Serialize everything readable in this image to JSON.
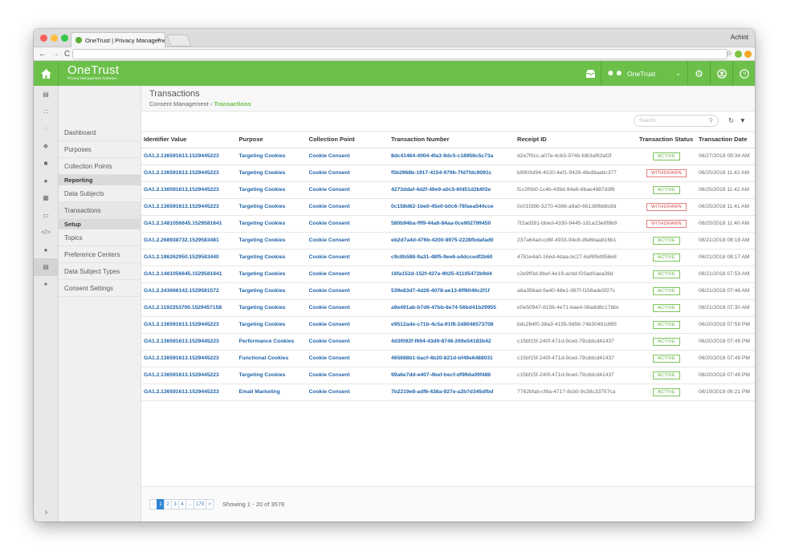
{
  "browser": {
    "tab_title": "OneTrust | Privacy Manageme",
    "tab_close": "×",
    "user": "Achint",
    "back": "←",
    "forward": "→",
    "reload": "C",
    "star": "☆"
  },
  "topbar": {
    "logo": "OneTrust",
    "logo_tagline": "Privacy Management Software",
    "org_name": "OneTrust",
    "accent_color": "#6cc04a"
  },
  "subnav": {
    "items_top": [
      "Dashboard",
      "Purposes",
      "Collection Points"
    ],
    "section_reporting": "Reporting",
    "items_reporting": [
      "Data Subjects",
      "Transactions"
    ],
    "section_setup": "Setup",
    "items_setup": [
      "Topics",
      "Preference Centers",
      "Data Subject Types",
      "Consent Settings"
    ]
  },
  "page": {
    "title": "Transactions",
    "crumb_parent": "Consent Management",
    "crumb_sep": " › ",
    "crumb_current": "Transactions"
  },
  "search": {
    "placeholder": "Search"
  },
  "table": {
    "headers": [
      "Identifier Value",
      "Purpose",
      "Collection Point",
      "Transaction Number",
      "Receipt ID",
      "Transaction Status",
      "Transaction Date"
    ],
    "rows": [
      [
        "GA1.2.136591613.1529445223",
        "Targeting Cookies",
        "Cookie Consent",
        "8dc41464-4004-4fa3-9dc5-c18956c5c73a",
        "d2e7f0cc-a07e-4cb3-974b-fd63af63af2f",
        "ACTIVE",
        "06/27/2018 09:34 AM"
      ],
      [
        "GA1.2.136591613.1529445223",
        "Targeting Cookies",
        "Cookie Consent",
        "f5b2968b-1917-4154-979b-7fd7fdc9091c",
        "b9903d94-4020-4ef1-9426-4fed8aabc377",
        "WITHDRAWN",
        "06/25/2018 11:42 AM"
      ],
      [
        "GA1.2.136591613.1529445223",
        "Targeting Cookies",
        "Cookie Consent",
        "4273ddaf-4d2f-49e9-a0c5-6fd51d2b6f2e",
        "f1c2f0b0-1c4b-439d-94e6-6bae4987d3f6",
        "ACTIVE",
        "06/25/2018 11:42 AM"
      ],
      [
        "GA1.2.136591613.1529445223",
        "Targeting Cookies",
        "Cookie Consent",
        "0c158d62-1be0-45e0-b0c6-78faea544cce",
        "0c01f39b-3270-4366-a9a0-66138fbb8c8d",
        "WITHDRAWN",
        "06/25/2018 11:41 AM"
      ],
      [
        "GA1.2.1481056645.1529581641",
        "Targeting Cookies",
        "Cookie Consent",
        "580b94ba-fff9-44a6-84aa-0ce902799450",
        "7f2ad391-bbed-4330-9445-181a23e8f9b9",
        "WITHDRAWN",
        "06/25/2018 11:40 AM"
      ],
      [
        "GA1.2.268938732.1529583481",
        "Targeting Cookies",
        "Cookie Consent",
        "eb2d7a4d-476b-4200-8975-2228fbdafad0",
        "237a64ad-cd6f-4933-94c8-dfe6baa816b1",
        "ACTIVE",
        "06/21/2018 08:18 AM"
      ],
      [
        "GA1.2.186262950.1529583440",
        "Targeting Cookies",
        "Cookie Consent",
        "c9c8b588-9a31-48f5-9ee6-a4dccedf2b60",
        "4781e4a0-16ed-4daa-bc27-6af6f6d956e8",
        "ACTIVE",
        "06/21/2018 08:17 AM"
      ],
      [
        "GA1.2.1481056645.1529581641",
        "Targeting Cookies",
        "Cookie Consent",
        "16fa152d-152f-437e-9025-41105472b9d4",
        "c2e9ff3d-8bef-4e19-acbd-f20ad0aea36d",
        "ACTIVE",
        "06/21/2018 07:53 AM"
      ],
      [
        "GA1.2.343666142.1529581572",
        "Targeting Cookies",
        "Cookie Consent",
        "539e83d7-4d26-4078-ae13-8ff6046c2f1f",
        "a6a356ad-9a40-48e1-967f-f156ade5f27c",
        "ACTIVE",
        "06/21/2018 07:46 AM"
      ],
      [
        "GA1.2.1192253700.1529457158",
        "Targeting Cookies",
        "Cookie Consent",
        "a9e491ab-b7d6-47bb-8e74-56bd41b29955",
        "e0e50947-8156-4e71-bae4-08a8d8c17bbc",
        "ACTIVE",
        "06/21/2018 07:30 AM"
      ],
      [
        "GA1.2.136591613.1529445223",
        "Targeting Cookies",
        "Cookie Consent",
        "e9512ade-c71b-4c5a-91f8-2d8046573708",
        "bdc264f0-38a3-4155-9d58-74b30491df65",
        "ACTIVE",
        "06/20/2018 07:59 PM"
      ],
      [
        "GA1.2.136591613.1529445223",
        "Performance Cookies",
        "Cookie Consent",
        "4d3f092f-f694-43d9-8746-269e54183b42",
        "c15bf15f-240f-471d-9ced-79cddcd41437",
        "ACTIVE",
        "06/20/2018 07:49 PM"
      ],
      [
        "GA1.2.136591613.1529445223",
        "Functional Cookies",
        "Cookie Consent",
        "465688b1-bacf-4b20-821d-bf49e6488031",
        "c15bf15f-240f-471d-9ced-79cddcd41437",
        "ACTIVE",
        "06/20/2018 07:49 PM"
      ],
      [
        "GA1.2.136591613.1529445223",
        "Targeting Cookies",
        "Cookie Consent",
        "99a6e7dd-e407-4bef-becf-df99da09f486",
        "c15bf15f-240f-471d-9ced-79cddcd41437",
        "ACTIVE",
        "06/20/2018 07:49 PM"
      ],
      [
        "GA1.2.136591613.1529445223",
        "Email Marketing",
        "Cookie Consent",
        "7b2219e8-adf6-438a-927e-a2b7d345dfbd",
        "7762bfab-cf8a-4717-8cb0-9c38c33757ca",
        "ACTIVE",
        "06/19/2018 06:21 PM"
      ]
    ]
  },
  "pagination": {
    "pages": [
      "<",
      "1",
      "2",
      "3",
      "4",
      "...",
      "179",
      ">"
    ],
    "current": "1",
    "showing": "Showing 1 - 20 of 3578"
  },
  "icons": [
    "home-icon",
    "inbox-icon",
    "users-icon",
    "gear-icon",
    "user-circle-icon",
    "help-icon",
    "refresh-icon",
    "filter-icon",
    "search-icon"
  ]
}
